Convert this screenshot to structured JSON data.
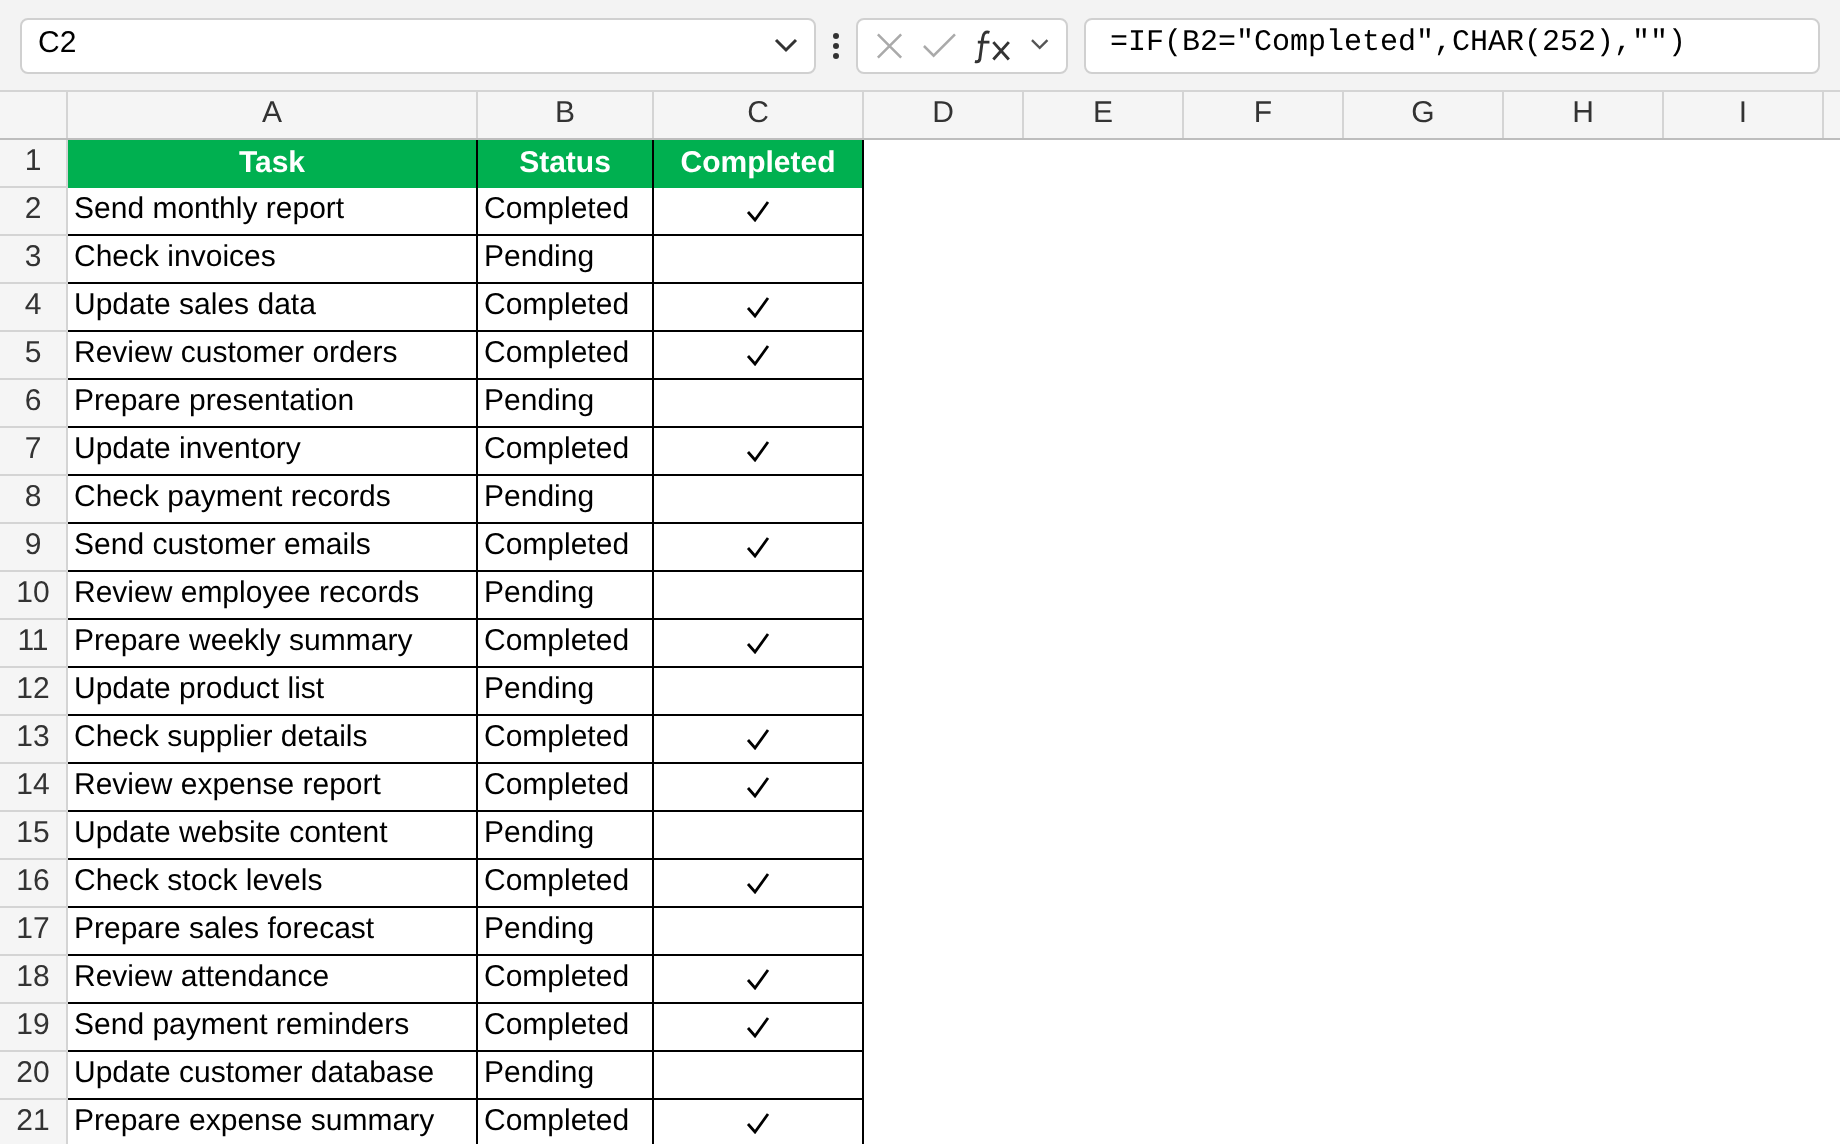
{
  "name_box": {
    "value": "C2"
  },
  "formula_bar": {
    "value": "=IF(B2=\"Completed\",CHAR(252),\"\")"
  },
  "column_headers": [
    "A",
    "B",
    "C",
    "D",
    "E",
    "F",
    "G",
    "H",
    "I"
  ],
  "table_header": {
    "row_number": "1",
    "cells": [
      "Task",
      "Status",
      "Completed"
    ]
  },
  "rows": [
    {
      "row_number": "2",
      "task": "Send monthly report",
      "status": "Completed",
      "completed": true
    },
    {
      "row_number": "3",
      "task": "Check invoices",
      "status": "Pending",
      "completed": false
    },
    {
      "row_number": "4",
      "task": "Update sales data",
      "status": "Completed",
      "completed": true
    },
    {
      "row_number": "5",
      "task": "Review customer orders",
      "status": "Completed",
      "completed": true
    },
    {
      "row_number": "6",
      "task": "Prepare presentation",
      "status": "Pending",
      "completed": false
    },
    {
      "row_number": "7",
      "task": "Update inventory",
      "status": "Completed",
      "completed": true
    },
    {
      "row_number": "8",
      "task": "Check payment records",
      "status": "Pending",
      "completed": false
    },
    {
      "row_number": "9",
      "task": "Send customer emails",
      "status": "Completed",
      "completed": true
    },
    {
      "row_number": "10",
      "task": "Review employee records",
      "status": "Pending",
      "completed": false
    },
    {
      "row_number": "11",
      "task": "Prepare weekly summary",
      "status": "Completed",
      "completed": true
    },
    {
      "row_number": "12",
      "task": "Update product list",
      "status": "Pending",
      "completed": false
    },
    {
      "row_number": "13",
      "task": "Check supplier details",
      "status": "Completed",
      "completed": true
    },
    {
      "row_number": "14",
      "task": "Review expense report",
      "status": "Completed",
      "completed": true
    },
    {
      "row_number": "15",
      "task": "Update website content",
      "status": "Pending",
      "completed": false
    },
    {
      "row_number": "16",
      "task": "Check stock levels",
      "status": "Completed",
      "completed": true
    },
    {
      "row_number": "17",
      "task": "Prepare sales forecast",
      "status": "Pending",
      "completed": false
    },
    {
      "row_number": "18",
      "task": "Review attendance",
      "status": "Completed",
      "completed": true
    },
    {
      "row_number": "19",
      "task": "Send payment reminders",
      "status": "Completed",
      "completed": true
    },
    {
      "row_number": "20",
      "task": "Update customer database",
      "status": "Pending",
      "completed": false
    },
    {
      "row_number": "21",
      "task": "Prepare expense summary",
      "status": "Completed",
      "completed": true
    }
  ]
}
